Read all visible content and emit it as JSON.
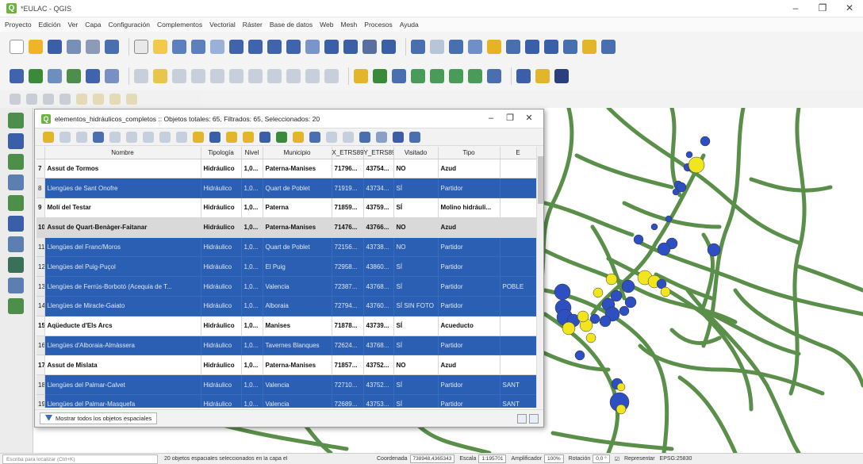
{
  "window": {
    "title": "*EULAC - QGIS",
    "controls": [
      "–",
      "❐",
      "✕"
    ]
  },
  "menu": [
    "Proyecto",
    "Edición",
    "Ver",
    "Capa",
    "Configuración",
    "Complementos",
    "Vectorial",
    "Ráster",
    "Base de datos",
    "Web",
    "Mesh",
    "Procesos",
    "Ayuda"
  ],
  "colors": {
    "selection": "#2b5fb3",
    "road": "#5a8f4a",
    "point_blue": "#2d4fc1",
    "point_yellow": "#f0e51f",
    "qgis_green": "#6cb33f"
  },
  "attribute_table": {
    "title": "elementos_hidráulicos_completos :: Objetos totales: 65, Filtrados: 65, Seleccionados: 20",
    "columns": [
      "Nombre",
      "Tipología",
      "Nivel",
      "Municipio",
      "X_ETRS89",
      "Y_ETRS89",
      "Visitado",
      "Tipo",
      "E"
    ],
    "rows": [
      {
        "n": "7",
        "state": "plain",
        "cells": [
          "Assut de Tormos",
          "Hidráulico",
          "1,0...",
          "Paterna-Manises",
          "71796...",
          "43754...",
          "NO",
          "Azud",
          ""
        ]
      },
      {
        "n": "8",
        "state": "sel",
        "cells": [
          "Llengües de Sant Onofre",
          "Hidráulico",
          "1,0...",
          "Quart de Poblet",
          "71919...",
          "43734...",
          "SÍ",
          "Partidor",
          ""
        ]
      },
      {
        "n": "9",
        "state": "plain",
        "cells": [
          "Molí del Testar",
          "Hidráulico",
          "1,0...",
          "Paterna",
          "71859...",
          "43759...",
          "SÍ",
          "Molino hidráuli...",
          ""
        ]
      },
      {
        "n": "10",
        "state": "cur",
        "cells": [
          "Assut de Quart-Benàger-Faitanar",
          "Hidráulico",
          "1,0...",
          "Paterna-Manises",
          "71476...",
          "43766...",
          "NO",
          "Azud",
          ""
        ]
      },
      {
        "n": "11",
        "state": "sel",
        "cells": [
          "Llengües del Franc/Moros",
          "Hidráulico",
          "1,0...",
          "Quart de Poblet",
          "72156...",
          "43738...",
          "NO",
          "Partidor",
          ""
        ]
      },
      {
        "n": "12",
        "state": "sel",
        "cells": [
          "Llengües del Puig-Puçol",
          "Hidráulico",
          "1,0...",
          "El Puig",
          "72958...",
          "43860...",
          "SÍ",
          "Partidor",
          ""
        ]
      },
      {
        "n": "13",
        "state": "sel",
        "cells": [
          "Llengües de Ferrús-Borbotó (Acequia de T...",
          "Hidráulico",
          "1,0...",
          "Valencia",
          "72387...",
          "43768...",
          "SÍ",
          "Partidor",
          "POBLE"
        ]
      },
      {
        "n": "14",
        "state": "sel",
        "cells": [
          "Llengües de Miracle-Gaiato",
          "Hidráulico",
          "1,0...",
          "Alboraia",
          "72794...",
          "43760...",
          "SÍ SIN FOTO",
          "Partidor",
          ""
        ]
      },
      {
        "n": "15",
        "state": "plain",
        "cells": [
          "Aqüeducte d'Els Arcs",
          "Hidráulico",
          "1,0...",
          "Manises",
          "71878...",
          "43739...",
          "SÍ",
          "Acueducto",
          ""
        ]
      },
      {
        "n": "16",
        "state": "sel",
        "cells": [
          "Llengües d'Alboraia-Almàssera",
          "Hidráulico",
          "1,0...",
          "Tavernes Blanques",
          "72624...",
          "43768...",
          "SÍ",
          "Partidor",
          ""
        ]
      },
      {
        "n": "17",
        "state": "plain",
        "cells": [
          "Assut de Mislata",
          "Hidráulico",
          "1,0...",
          "Paterna-Manises",
          "71857...",
          "43752...",
          "NO",
          "Azud",
          ""
        ]
      },
      {
        "n": "18",
        "state": "sel",
        "cells": [
          "Llengües del Palmar-Calvet",
          "Hidráulico",
          "1,0...",
          "Valencia",
          "72710...",
          "43752...",
          "SÍ",
          "Partidor",
          "SANT"
        ]
      },
      {
        "n": "19",
        "state": "sel",
        "cells": [
          "Llengües del Palmar-Masquefa",
          "Hidráulico",
          "1,0...",
          "Valencia",
          "72689...",
          "43753...",
          "SÍ",
          "Partidor",
          "SANT"
        ]
      }
    ],
    "footer_button": "Mostrar todos los objetos espaciales"
  },
  "statusbar": {
    "search_placeholder": "Escriba para localizar (Ctrl+K)",
    "message": "20 objetos espaciales seleccionados en la capa el",
    "coord_label": "Coordenada",
    "coord_value": "738948,4365343",
    "scale_label": "Escala",
    "scale_value": "1:195701",
    "magnifier_label": "Amplificador",
    "magnifier_value": "100%",
    "rotation_label": "Rotación",
    "rotation_value": "0,0 °",
    "render_label": "Representar",
    "crs": "EPSG:25830"
  }
}
